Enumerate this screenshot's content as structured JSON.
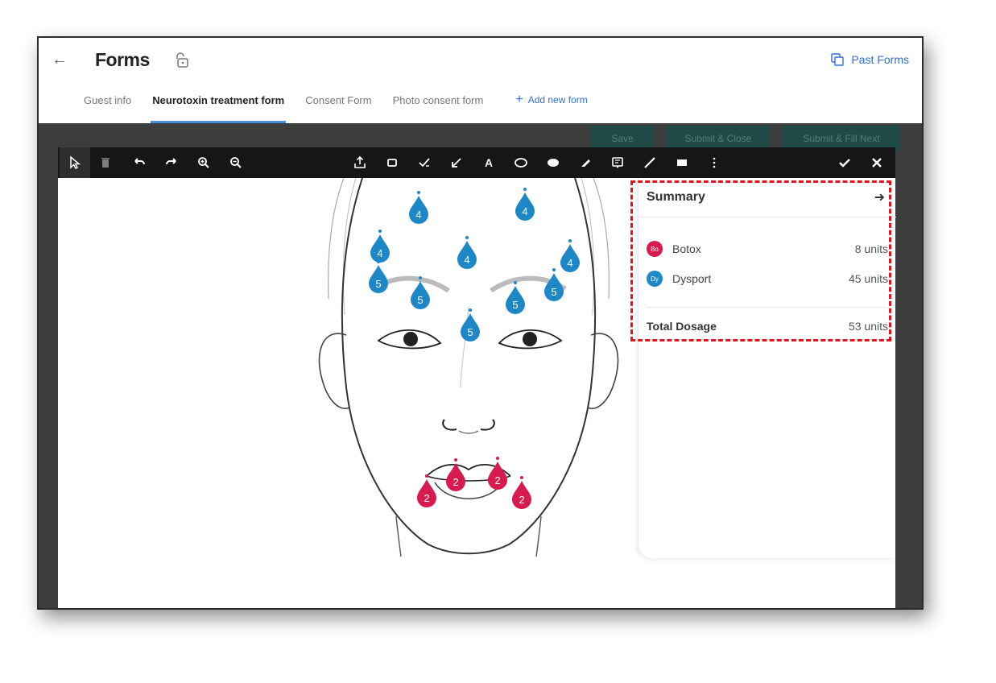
{
  "header": {
    "title": "Forms",
    "past_forms_label": "Past Forms"
  },
  "tabs": [
    {
      "label": "Guest info"
    },
    {
      "label": "Neurotoxin treatment form",
      "active": true
    },
    {
      "label": "Consent Form"
    },
    {
      "label": "Photo consent form"
    }
  ],
  "add_form_label": "Add new form",
  "actions": {
    "save": "Save",
    "submit_close": "Submit & Close",
    "submit_fill_next": "Submit & Fill Next"
  },
  "toolbar": {
    "tools": [
      "select-icon",
      "trash-icon",
      "undo-icon",
      "redo-icon",
      "zoom-in-icon",
      "zoom-out-icon",
      "upload-icon",
      "rectangle-icon",
      "checkmark-draw-icon",
      "arrow-icon",
      "text-icon",
      "ellipse-icon",
      "filled-ellipse-icon",
      "pen-icon",
      "note-icon",
      "line-icon",
      "filled-rect-icon",
      "more-icon",
      "confirm-icon",
      "close-icon"
    ],
    "text_tool_glyph": "A"
  },
  "summary": {
    "title": "Summary",
    "products": [
      {
        "badge": "Bo",
        "name": "Botox",
        "value": "8 units",
        "color": "#d81b4e"
      },
      {
        "badge": "Dy",
        "name": "Dysport",
        "value": "45 units",
        "color": "#1e88c7"
      }
    ],
    "total_label": "Total Dosage",
    "total_value": "53 units"
  },
  "injection_points": {
    "dysport": [
      "4",
      "4",
      "4",
      "4",
      "4",
      "5",
      "5",
      "5",
      "5",
      "5"
    ],
    "botox": [
      "2",
      "2",
      "2",
      "2"
    ]
  },
  "colors": {
    "dysport": "#1e88c7",
    "botox": "#d81b4e",
    "tab_underline": "#4a8fd8",
    "link": "#2f6fd6",
    "highlight": "#e0141c"
  }
}
